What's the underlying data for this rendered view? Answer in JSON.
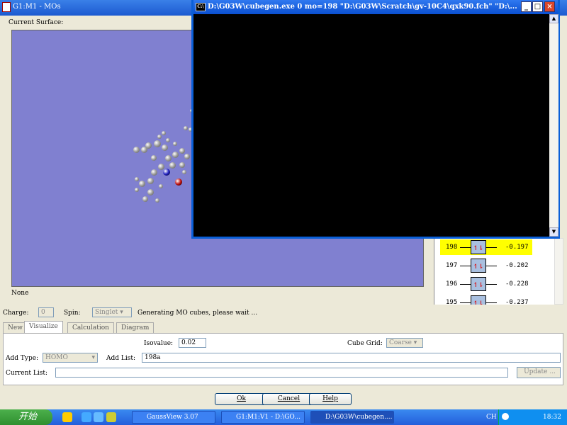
{
  "main_window": {
    "title": "G1:M1 - MOs",
    "current_surface_label": "Current Surface:",
    "surface_status": "None"
  },
  "console": {
    "title": "D:\\G03W\\cubegen.exe 0 mo=198 \"D:\\G03W\\Scratch\\gv-10C4\\qxk90.fch\" \"D:\\...",
    "icon_text": "C:\\",
    "min": "_",
    "max": "□",
    "close": "×"
  },
  "mo_list": [
    {
      "num": "198",
      "energy": "-0.197",
      "occ": "↿⇂",
      "selected": true
    },
    {
      "num": "197",
      "energy": "-0.202",
      "occ": "↿⇂"
    },
    {
      "num": "196",
      "energy": "-0.228",
      "occ": "↿⇂"
    },
    {
      "num": "195",
      "energy": "-0.237",
      "occ": "↿⇂"
    }
  ],
  "status": {
    "charge_label": "Charge:",
    "charge": "0",
    "spin_label": "Spin:",
    "spin": "Singlet",
    "message": "Generating MO cubes, please wait ..."
  },
  "tabs": [
    "New",
    "Visualize",
    "Calculation",
    "Diagram"
  ],
  "visualize": {
    "isovalue_label": "Isovalue:",
    "isovalue": "0.02",
    "cube_grid_label": "Cube Grid:",
    "cube_grid": "Coarse",
    "add_type_label": "Add Type:",
    "add_type": "HOMO",
    "add_list_label": "Add List:",
    "add_list": "198a",
    "current_list_label": "Current List:",
    "current_list": "",
    "update": "Update ..."
  },
  "buttons": {
    "ok": "Ok",
    "cancel": "Cancel",
    "help": "Help"
  },
  "taskbar": {
    "start": "开始",
    "tasks": [
      "GaussView 3.07",
      "G1:M1:V1 - D:\\GO...",
      "D:\\G03W\\cubegen...."
    ],
    "lang": "CH",
    "clock": "18:32"
  }
}
